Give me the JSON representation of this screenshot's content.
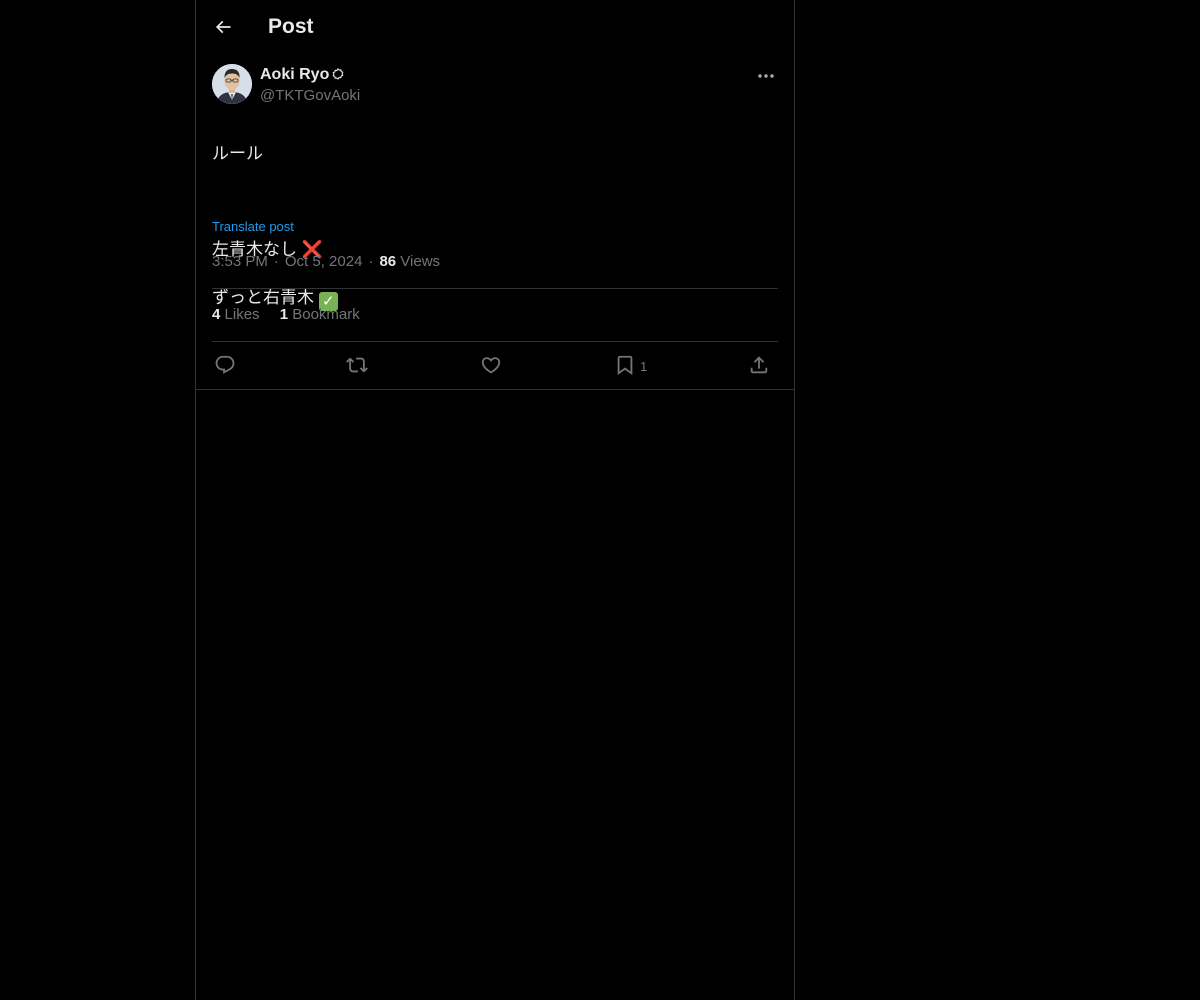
{
  "header": {
    "title": "Post",
    "back_icon": "arrow-left-icon"
  },
  "author": {
    "display_name": "Aoki Ryo",
    "handle": "@TKTGovAoki",
    "verified_icon": "verified-badge-icon"
  },
  "post": {
    "text_line1": "ルール",
    "text_line2": "左青木なし",
    "text_line2_emoji": "❌",
    "text_line3": "ずっと右青木",
    "text_line3_emoji": "✓",
    "translate_label": "Translate post"
  },
  "meta": {
    "time": "3:53 PM",
    "date": "Oct 5, 2024",
    "views_count": "86",
    "views_label": "Views"
  },
  "stats": {
    "likes_count": "4",
    "likes_label": "Likes",
    "bookmarks_count": "1",
    "bookmarks_label": "Bookmark"
  },
  "actions": {
    "bookmark_count": "1"
  },
  "colors": {
    "background": "#000000",
    "text_primary": "#e7e9ea",
    "text_secondary": "#71767b",
    "link": "#1d9bf0",
    "border": "#2f3336"
  }
}
